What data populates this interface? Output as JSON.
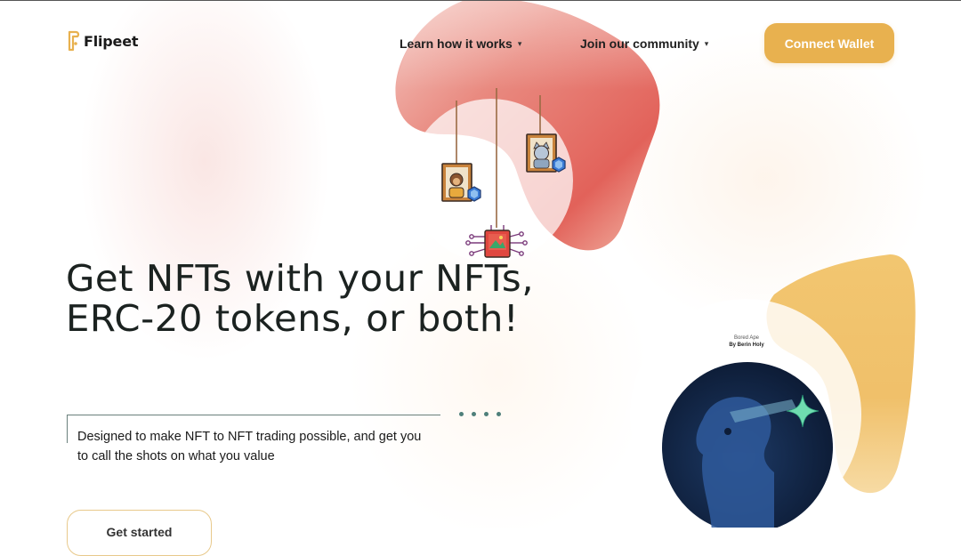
{
  "brand": {
    "name": "Flipeet",
    "accent": "#e8b14f"
  },
  "nav": {
    "items": [
      {
        "label": "Learn how it works",
        "icon": "chevron-down-icon"
      },
      {
        "label": "Join our community",
        "icon": "chevron-down-icon"
      }
    ],
    "connect_label": "Connect Wallet"
  },
  "hero": {
    "headline": "Get NFTs with your NFTs, ERC-20 tokens, or both!",
    "subtext": "Designed to make NFT to NFT trading possible, and get you to call the shots on what you value",
    "cta_label": "Get started"
  },
  "nft_card": {
    "title": "Bored Ape",
    "author": "By Berin Holy"
  },
  "colors": {
    "text_dark": "#1b2220",
    "coral_blob": "#e0675e",
    "gold_blob": "#efc067",
    "navy_card": "#0e1e3a",
    "teal_dots": "#4e7f7a"
  },
  "icons": [
    "flipeet-logo-icon",
    "chevron-down-icon",
    "monkey-frame-icon",
    "cat-frame-icon",
    "nft-chip-icon",
    "sparkle-icon",
    "ethereum-badge-icon"
  ]
}
